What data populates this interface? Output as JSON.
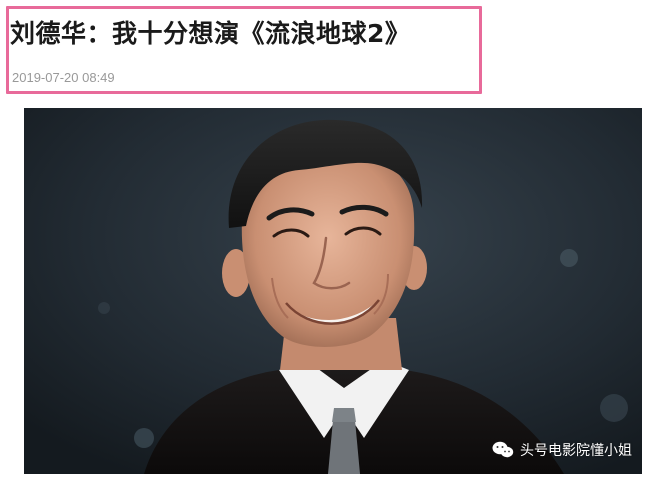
{
  "article": {
    "headline": "刘德华：我十分想演《流浪地球2》",
    "timestamp": "2019-07-20 08:49"
  },
  "photo": {
    "watermark_text": "头号电影院懂小姐",
    "watermark_icon": "wechat-icon"
  },
  "colors": {
    "highlight_border": "#e86a9a",
    "headline_text": "#1a1a1a",
    "timestamp_text": "#999999"
  }
}
